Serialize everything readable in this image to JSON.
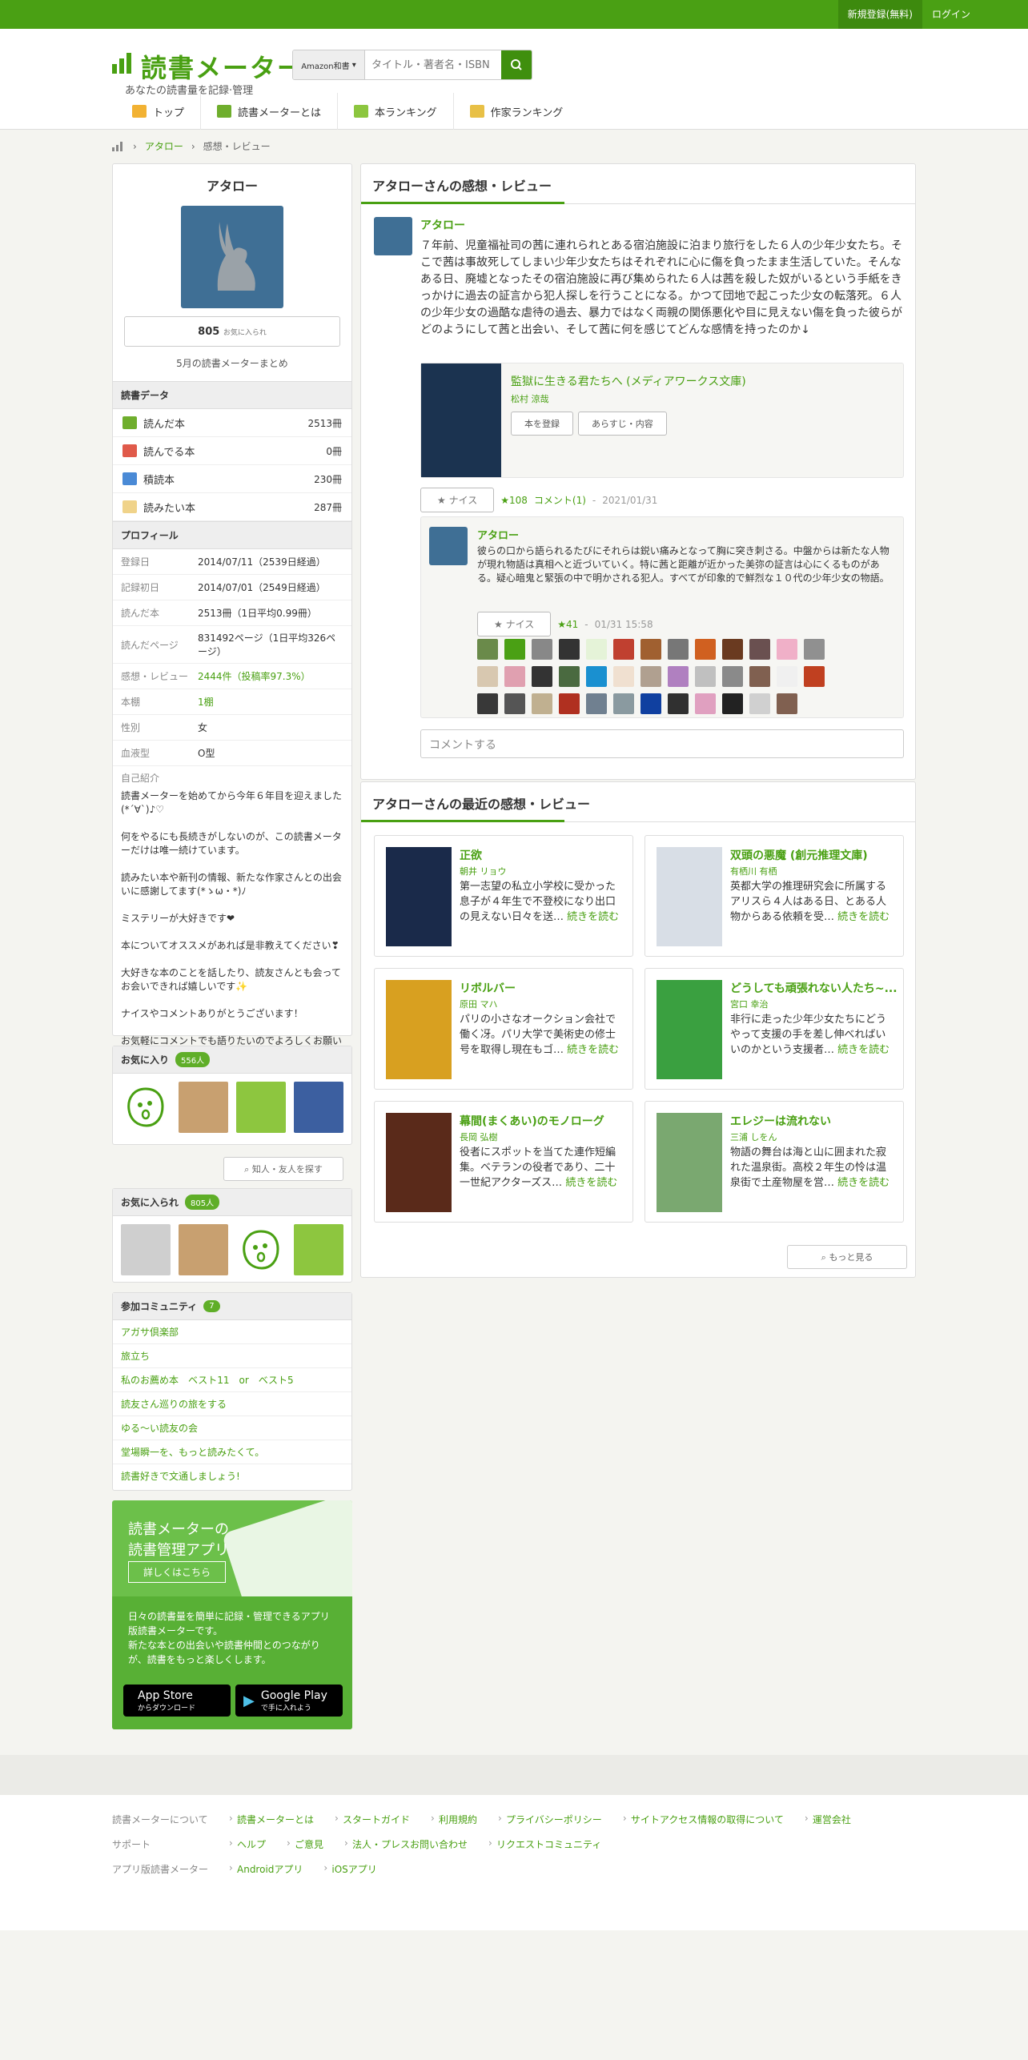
{
  "topbar": {
    "register": "新規登録(無料)",
    "login": "ログイン"
  },
  "header": {
    "logo_title": "読書メーター",
    "logo_sub": "あなたの読書量を記録·管理",
    "search_select": "Amazon和書",
    "search_placeholder": "タイトル・著者名・ISBN"
  },
  "nav": {
    "items": [
      "トップ",
      "読書メーターとは",
      "本ランキング",
      "作家ランキング"
    ]
  },
  "breadcrumb": {
    "user": "アタロー",
    "page": "感想・レビュー"
  },
  "profile": {
    "name": "アタロー",
    "fav_count": "805",
    "fav_label": "お気に入られ",
    "monthly": "5月の読書メーターまとめ",
    "data_header": "読書データ",
    "stats": [
      {
        "label": "読んだ本",
        "value": "2513冊"
      },
      {
        "label": "読んでる本",
        "value": "0冊"
      },
      {
        "label": "積読本",
        "value": "230冊"
      },
      {
        "label": "読みたい本",
        "value": "287冊"
      }
    ],
    "profile_header": "プロフィール",
    "rows": [
      {
        "k": "登録日",
        "v": "2014/07/11（2539日経過）"
      },
      {
        "k": "記録初日",
        "v": "2014/07/01（2549日経過）"
      },
      {
        "k": "読んだ本",
        "v": "2513冊（1日平均0.99冊）"
      },
      {
        "k": "読んだページ",
        "v": "831492ページ（1日平均326ページ）"
      },
      {
        "k": "感想・レビュー",
        "v": "2444件（投稿率97.3%）"
      },
      {
        "k": "本棚",
        "v": "1棚"
      },
      {
        "k": "性別",
        "v": "女"
      },
      {
        "k": "血液型",
        "v": "O型"
      }
    ],
    "intro_label": "自己紹介",
    "intro": [
      "読書メーターを始めてから今年６年目を迎えました(*´∀`)♪♡",
      "何をやるにも長続きがしないのが、この読書メーターだけは唯一続けています。",
      "読みたい本や新刊の情報、新たな作家さんとの出会いに感謝してます(*ゝω・*)ﾉ",
      "ミステリーが大好きです❤",
      "本についてオススメがあれば是非教えてください❣",
      "大好きな本のことを話したり、読友さんとも会ってお会いできれば嬉しいです✨",
      "ナイスやコメントありがとうございます！",
      "お気軽にコメントでも語りたいのでよろしくお願いします!"
    ]
  },
  "favorites": {
    "title": "お気に入り",
    "count": "556人",
    "find": "知人・友人を探す"
  },
  "favorited": {
    "title": "お気に入られ",
    "count": "805人"
  },
  "community": {
    "title": "参加コミュニティ",
    "badge": "7",
    "items": [
      "アガサ倶楽部",
      "旅立ち",
      "私のお薦め本　ベスト11　or　ベスト5",
      "読友さん巡りの旅をする",
      "ゆる～い読友の会",
      "堂場瞬一を、もっと読みたくて。",
      "読書好きで文通しましょう!"
    ]
  },
  "app": {
    "title1": "読書メーターの",
    "title2": "読書管理アプリ",
    "detail": "詳しくはこちら",
    "desc": [
      "日々の読書量を簡単に記録・管理できるアプリ版読書メーターです。",
      "新たな本との出会いや読書仲間とのつながりが、読書をもっと楽しくします。"
    ],
    "appstore": "App Store",
    "appstore_sub": "からダウンロード",
    "gplay": "Google Play",
    "gplay_sub": "で手に入れよう"
  },
  "review": {
    "header": "アタローさんの感想・レビュー",
    "user": "アタロー",
    "text": "７年前、児童福祉司の茜に連れられとある宿泊施設に泊まり旅行をした６人の少年少女たち。そこで茜は事故死してしまい少年少女たちはそれぞれに心に傷を負ったまま生活していた。そんなある日、廃墟となったその宿泊施設に再び集められた６人は茜を殺した奴がいるという手紙をきっかけに過去の証言から犯人探しを行うことになる。かつて団地で起こった少女の転落死。６人の少年少女の過酷な虐待の過去、暴力ではなく両親の関係悪化や目に見えない傷を負った彼らがどのようにして茜と出会い、そして茜に何を感じてどんな感情を持ったのか↓",
    "book_title": "監獄に生きる君たちへ (メディアワークス文庫)",
    "book_author": "松村 涼哉",
    "btn_register": "本を登録",
    "btn_summary": "あらすじ・内容",
    "nice": "ナイス",
    "nice_count": "★108",
    "comments": "コメント(1)",
    "date": "2021/01/31",
    "comment_user": "アタロー",
    "comment_text": "彼らの口から語られるたびにそれらは鋭い痛みとなって胸に突き刺さる。中盤からは新たな人物が現れ物語は真相へと近づいていく。特に茜と距離が近かった美弥の証言は心にくるものがある。疑心暗鬼と緊張の中で明かされる犯人。すべてが印象的で鮮烈な１０代の少年少女の物語。",
    "comment_nice_count": "★41",
    "comment_date": "01/31 15:58",
    "comment_placeholder": "コメントする"
  },
  "recent": {
    "header": "アタローさんの最近の感想・レビュー",
    "more": "もっと見る",
    "readmore": "続きを読む",
    "cards": [
      {
        "title": "正欲",
        "author": "朝井 リョウ",
        "desc": "第一志望の私立小学校に受かった息子が４年生で不登校になり出口の見えない日々を送…"
      },
      {
        "title": "双頭の悪魔 (創元推理文庫)",
        "author": "有栖川 有栖",
        "desc": "英都大学の推理研究会に所属するアリスら４人はある日、とある人物からある依頼を受…"
      },
      {
        "title": "リボルバー",
        "author": "原田 マハ",
        "desc": "パリの小さなオークション会社で働く冴。パリ大学で美術史の修士号を取得し現在もゴ…"
      },
      {
        "title": "どうしても頑張れない人たち~...",
        "author": "宮口 幸治",
        "desc": "非行に走った少年少女たちにどうやって支援の手を差し伸べればいいのかという支援者…"
      },
      {
        "title": "幕間(まくあい)のモノローグ",
        "author": "長岡 弘樹",
        "desc": "役者にスポットを当てた連作短編集。ベテランの役者であり、二十一世紀アクターズス…"
      },
      {
        "title": "エレジーは流れない",
        "author": "三浦 しをん",
        "desc": "物語の舞台は海と山に囲まれた寂れた温泉街。高校２年生の怜は温泉街で土産物屋を営…"
      }
    ]
  },
  "footer": {
    "rows": [
      {
        "k": "読書メーターについて",
        "links": [
          "読書メーターとは",
          "スタートガイド",
          "利用規約",
          "プライバシーポリシー",
          "サイトアクセス情報の取得について",
          "運営会社"
        ]
      },
      {
        "k": "サポート",
        "links": [
          "ヘルプ",
          "ご意見",
          "法人・プレスお問い合わせ",
          "リクエストコミュニティ"
        ]
      },
      {
        "k": "アプリ版読書メーター",
        "links": [
          "Androidアプリ",
          "iOSアプリ"
        ]
      }
    ]
  }
}
